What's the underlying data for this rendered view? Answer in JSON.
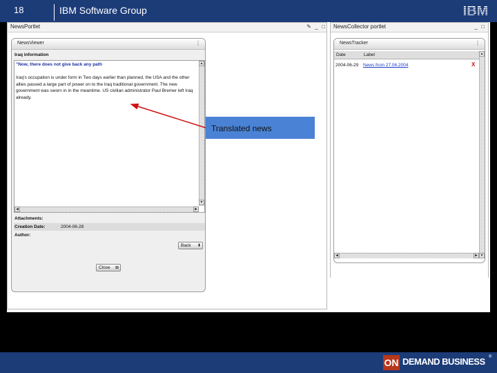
{
  "slide": {
    "number": "18",
    "group": "IBM Software Group",
    "logo": "IBM",
    "footer_on": "ON",
    "footer_text": "DEMAND BUSINESS",
    "footer_tm": "®"
  },
  "left_portlet": {
    "title": "NewsPortlet",
    "viewer": {
      "title": "NewsViewer",
      "section_label": "Iraq information",
      "headline": "\"Now, there does not give back any path",
      "body": "Iraq's occupation is under form in Two days earlier than planned, the USA and the other allies passed a large part of power on to the Iraq traditional government. The new government was sworn in in the meantime. US civilian administrator Paul Bremer left Iraq already.",
      "attachments_label": "Attachments:",
      "creation_date_label": "Creation Date:",
      "creation_date_value": "2004-06-28",
      "author_label": "Author:",
      "back_button": "Back",
      "close_button": "Close"
    }
  },
  "right_portlet": {
    "title": "NewsCollector portlet",
    "tracker": {
      "title": "NewsTracker",
      "columns": [
        "Date",
        "Label"
      ],
      "rows": [
        {
          "date": "2004-06-29",
          "label": "News from 27.06.2004",
          "delete": "X"
        }
      ]
    }
  },
  "callout": {
    "text": "Translated news"
  },
  "colors": {
    "header_bg": "#1c3c78",
    "callout_bg": "#4a83d6",
    "arrow": "#d01010",
    "link": "#1a3ec8",
    "on_box": "#b6371c"
  },
  "icons": {
    "edit": "pencil-icon",
    "minimize": "minimize-icon",
    "maximize": "maximize-icon",
    "menu": "vertical-dots-icon",
    "delete": "x-icon"
  }
}
